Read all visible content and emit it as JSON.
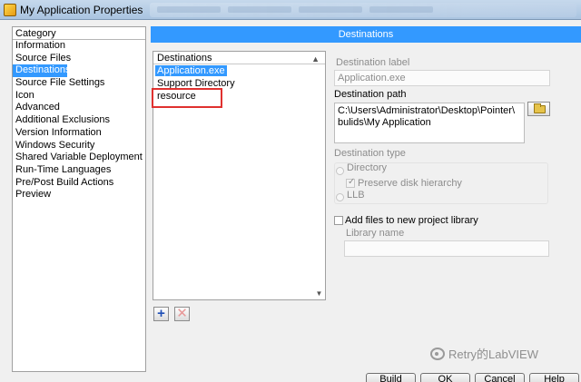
{
  "window": {
    "title": "My Application Properties"
  },
  "category": {
    "header": "Category",
    "items": [
      "Information",
      "Source Files",
      "Destinations",
      "Source File Settings",
      "Icon",
      "Advanced",
      "Additional Exclusions",
      "Version Information",
      "Windows Security",
      "Shared Variable Deployment",
      "Run-Time Languages",
      "Pre/Post Build Actions",
      "Preview"
    ],
    "selected": "Destinations"
  },
  "banner": {
    "title": "Destinations"
  },
  "destinations": {
    "header": "Destinations",
    "items": [
      "Application.exe",
      "Support Directory",
      "resource"
    ],
    "selected": "Application.exe",
    "highlighted": "resource",
    "highlight_color": "#e0312f"
  },
  "form": {
    "destination_label": {
      "label": "Destination label",
      "value": "Application.exe"
    },
    "destination_path": {
      "label": "Destination path",
      "line1": "C:\\Users\\Administrator\\Desktop\\Pointer\\",
      "line2": "bulids\\My Application"
    },
    "destination_type": {
      "label": "Destination type",
      "directory": "Directory",
      "preserve": "Preserve disk hierarchy",
      "llb": "LLB"
    },
    "add_files": {
      "label": "Add files to new project library",
      "library_name_label": "Library name",
      "library_name_value": ""
    }
  },
  "buttons": {
    "build": "Build",
    "ok": "OK",
    "cancel": "Cancel",
    "help": "Help"
  },
  "watermark": {
    "text": "Retry的LabVIEW"
  },
  "colors": {
    "selection": "#3399ff",
    "banner": "#3399ff",
    "highlight_box": "#e0312f"
  }
}
